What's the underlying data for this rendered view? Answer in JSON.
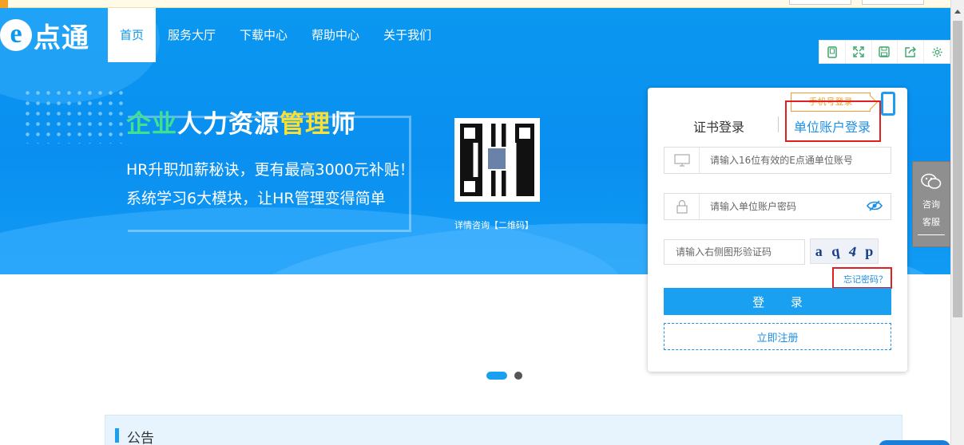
{
  "nav": {
    "logo_letter": "e",
    "logo_text": "点通",
    "items": [
      "首页",
      "服务大厅",
      "下载中心",
      "帮助中心",
      "关于我们"
    ],
    "active_index": 0
  },
  "toolbar": {
    "icons": [
      "mobile-icon",
      "fullscreen-icon",
      "save-icon",
      "share-icon",
      "settings-icon"
    ]
  },
  "banner": {
    "title_parts": [
      {
        "text": "企业",
        "color": "green"
      },
      {
        "text": "人力资源",
        "color": "white"
      },
      {
        "text": "管理",
        "color": "yellow"
      },
      {
        "text": "师",
        "color": "white"
      }
    ],
    "line1": "HR升职加薪秘诀，更有最高3000元补贴！",
    "line2": "系统学习6大模块，让HR管理变得简单",
    "qr_caption": "详情咨询【二维码】"
  },
  "login": {
    "phone_login_tag": "手机号登录",
    "tab_cert": "证书登录",
    "tab_unit": "单位账户登录",
    "account_placeholder": "请输入16位有效的E点通单位账号",
    "password_placeholder": "请输入单位账户密码",
    "captcha_placeholder": "请输入右侧图形验证码",
    "captcha_chars": [
      "a",
      "q",
      "4",
      "p"
    ],
    "forgot": "忘记密码？",
    "login_button": "登 录",
    "register_button": "立即注册"
  },
  "side_service": {
    "line1": "咨询",
    "line2": "客服"
  },
  "notice": {
    "title": "公告"
  },
  "colors": {
    "brand_blue": "#0a98f0",
    "link_blue": "#1e90e6",
    "highlight_red": "#e02020",
    "tag_orange": "#f0a030"
  }
}
